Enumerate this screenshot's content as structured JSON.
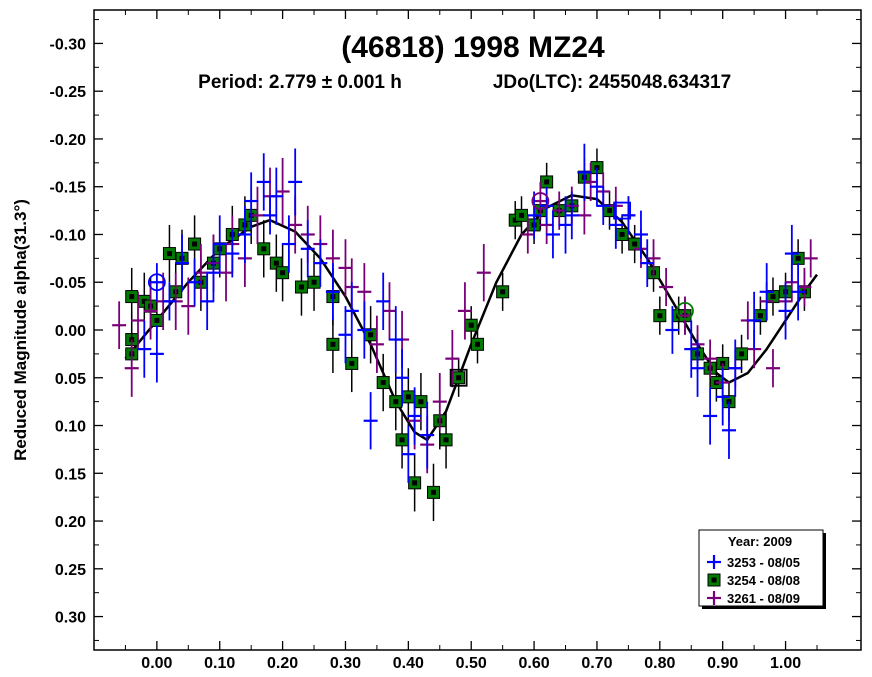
{
  "chart_data": {
    "type": "scatter",
    "title": "(46818) 1998 MZ24",
    "subtitle_period": "Period: 2.779 ± 0.001 h",
    "subtitle_epoch": "JDo(LTC): 2455048.634317",
    "ylabel": "Reduced Magnitude alpha(31.3°)",
    "xlabel": "",
    "xlim": [
      -0.1,
      1.12
    ],
    "ylim": [
      0.335,
      -0.335
    ],
    "y_inverted": true,
    "x_ticks": [
      "0.00",
      "0.10",
      "0.20",
      "0.30",
      "0.40",
      "0.50",
      "0.60",
      "0.70",
      "0.80",
      "0.90",
      "1.00"
    ],
    "y_ticks": [
      "-0.30",
      "-0.25",
      "-0.20",
      "-0.15",
      "-0.10",
      "-0.05",
      "0.00",
      "0.05",
      "0.10",
      "0.15",
      "0.20",
      "0.25",
      "0.30"
    ],
    "grid": false,
    "legend_position": "bottom-right",
    "legend_title": "Year: 2009",
    "series": [
      {
        "name": "3253 - 08/05",
        "marker": "plus",
        "color": "#0000ff",
        "points": [
          [
            -0.02,
            0.02,
            0.03
          ],
          [
            0.0,
            -0.05,
            0.02
          ],
          [
            0.0,
            0.025,
            0.03
          ],
          [
            0.02,
            -0.03,
            0.02
          ],
          [
            0.04,
            -0.07,
            0.03
          ],
          [
            0.06,
            -0.05,
            0.025
          ],
          [
            0.08,
            -0.03,
            0.03
          ],
          [
            0.09,
            -0.06,
            0.03
          ],
          [
            0.1,
            -0.09,
            0.03
          ],
          [
            0.12,
            -0.08,
            0.025
          ],
          [
            0.14,
            -0.1,
            0.03
          ],
          [
            0.15,
            -0.135,
            0.03
          ],
          [
            0.17,
            -0.155,
            0.03
          ],
          [
            0.18,
            -0.12,
            0.02
          ],
          [
            0.19,
            -0.14,
            0.03
          ],
          [
            0.21,
            -0.09,
            0.03
          ],
          [
            0.22,
            -0.155,
            0.035
          ],
          [
            0.24,
            -0.085,
            0.03
          ],
          [
            0.26,
            -0.07,
            0.025
          ],
          [
            0.28,
            -0.04,
            0.03
          ],
          [
            0.3,
            0.005,
            0.03
          ],
          [
            0.31,
            -0.02,
            0.03
          ],
          [
            0.33,
            0.0,
            0.03
          ],
          [
            0.34,
            0.095,
            0.03
          ],
          [
            0.36,
            -0.03,
            0.03
          ],
          [
            0.38,
            0.01,
            0.035
          ],
          [
            0.39,
            0.05,
            0.03
          ],
          [
            0.4,
            0.13,
            0.03
          ],
          [
            0.41,
            0.09,
            0.03
          ],
          [
            0.43,
            0.11,
            0.035
          ],
          [
            0.6,
            -0.12,
            0.025
          ],
          [
            0.62,
            -0.13,
            0.02
          ],
          [
            0.63,
            -0.1,
            0.025
          ],
          [
            0.65,
            -0.11,
            0.03
          ],
          [
            0.66,
            -0.12,
            0.025
          ],
          [
            0.68,
            -0.165,
            0.03
          ],
          [
            0.7,
            -0.15,
            0.02
          ],
          [
            0.71,
            -0.13,
            0.02
          ],
          [
            0.73,
            -0.11,
            0.025
          ],
          [
            0.75,
            -0.12,
            0.02
          ],
          [
            0.77,
            -0.1,
            0.025
          ],
          [
            0.78,
            -0.07,
            0.025
          ],
          [
            0.82,
            0.0,
            0.025
          ],
          [
            0.85,
            0.02,
            0.03
          ],
          [
            0.86,
            0.04,
            0.03
          ],
          [
            0.88,
            0.09,
            0.03
          ],
          [
            0.9,
            0.07,
            0.03
          ],
          [
            0.91,
            0.105,
            0.03
          ],
          [
            0.92,
            0.04,
            0.03
          ],
          [
            0.95,
            -0.01,
            0.03
          ],
          [
            0.97,
            -0.04,
            0.03
          ],
          [
            1.0,
            -0.02,
            0.03
          ],
          [
            1.01,
            -0.08,
            0.03
          ],
          [
            1.02,
            -0.04,
            0.03
          ]
        ]
      },
      {
        "name": "3254 - 08/08",
        "marker": "square",
        "color": "#007a00",
        "points": [
          [
            -0.04,
            0.01,
            0.03
          ],
          [
            -0.04,
            -0.035,
            0.03
          ],
          [
            -0.04,
            0.025,
            0.03
          ],
          [
            -0.02,
            -0.03,
            0.03
          ],
          [
            -0.01,
            -0.025,
            0.03
          ],
          [
            0.0,
            -0.01,
            0.02
          ],
          [
            0.02,
            -0.08,
            0.03
          ],
          [
            0.03,
            -0.04,
            0.03
          ],
          [
            0.04,
            -0.075,
            0.03
          ],
          [
            0.06,
            -0.09,
            0.03
          ],
          [
            0.07,
            -0.05,
            0.03
          ],
          [
            0.09,
            -0.07,
            0.03
          ],
          [
            0.1,
            -0.085,
            0.03
          ],
          [
            0.12,
            -0.1,
            0.03
          ],
          [
            0.14,
            -0.11,
            0.03
          ],
          [
            0.15,
            -0.12,
            0.03
          ],
          [
            0.17,
            -0.085,
            0.03
          ],
          [
            0.19,
            -0.07,
            0.03
          ],
          [
            0.2,
            -0.06,
            0.03
          ],
          [
            0.23,
            -0.045,
            0.03
          ],
          [
            0.25,
            -0.05,
            0.03
          ],
          [
            0.28,
            -0.035,
            0.03
          ],
          [
            0.28,
            0.015,
            0.03
          ],
          [
            0.31,
            0.035,
            0.03
          ],
          [
            0.34,
            0.005,
            0.03
          ],
          [
            0.36,
            0.055,
            0.03
          ],
          [
            0.38,
            0.075,
            0.03
          ],
          [
            0.39,
            0.115,
            0.03
          ],
          [
            0.4,
            0.07,
            0.03
          ],
          [
            0.41,
            0.16,
            0.03
          ],
          [
            0.42,
            0.075,
            0.03
          ],
          [
            0.44,
            0.17,
            0.03
          ],
          [
            0.45,
            0.095,
            0.03
          ],
          [
            0.46,
            0.115,
            0.03
          ],
          [
            0.48,
            0.05,
            0.02
          ],
          [
            0.5,
            -0.005,
            0.02
          ],
          [
            0.51,
            0.015,
            0.02
          ],
          [
            0.55,
            -0.04,
            0.02
          ],
          [
            0.57,
            -0.115,
            0.02
          ],
          [
            0.58,
            -0.12,
            0.02
          ],
          [
            0.6,
            -0.11,
            0.02
          ],
          [
            0.61,
            -0.125,
            0.02
          ],
          [
            0.62,
            -0.155,
            0.02
          ],
          [
            0.64,
            -0.125,
            0.02
          ],
          [
            0.66,
            -0.13,
            0.02
          ],
          [
            0.68,
            -0.16,
            0.02
          ],
          [
            0.7,
            -0.17,
            0.02
          ],
          [
            0.72,
            -0.125,
            0.02
          ],
          [
            0.74,
            -0.1,
            0.02
          ],
          [
            0.76,
            -0.09,
            0.02
          ],
          [
            0.79,
            -0.06,
            0.02
          ],
          [
            0.8,
            -0.015,
            0.02
          ],
          [
            0.83,
            -0.015,
            0.02
          ],
          [
            0.84,
            -0.015,
            0.02
          ],
          [
            0.86,
            0.025,
            0.02
          ],
          [
            0.88,
            0.04,
            0.02
          ],
          [
            0.89,
            0.055,
            0.02
          ],
          [
            0.9,
            0.035,
            0.02
          ],
          [
            0.91,
            0.075,
            0.02
          ],
          [
            0.93,
            0.025,
            0.02
          ],
          [
            0.96,
            -0.015,
            0.02
          ],
          [
            0.98,
            -0.035,
            0.02
          ],
          [
            1.0,
            -0.04,
            0.02
          ],
          [
            1.02,
            -0.075,
            0.02
          ],
          [
            1.03,
            -0.04,
            0.02
          ]
        ]
      },
      {
        "name": "3261 - 08/09",
        "marker": "plus",
        "color": "#7a007a",
        "points": [
          [
            -0.06,
            -0.005,
            0.025
          ],
          [
            -0.04,
            0.04,
            0.03
          ],
          [
            -0.03,
            -0.01,
            0.03
          ],
          [
            -0.01,
            -0.02,
            0.03
          ],
          [
            0.01,
            -0.03,
            0.03
          ],
          [
            0.03,
            -0.03,
            0.03
          ],
          [
            0.05,
            -0.025,
            0.03
          ],
          [
            0.07,
            -0.06,
            0.03
          ],
          [
            0.09,
            -0.07,
            0.03
          ],
          [
            0.11,
            -0.06,
            0.03
          ],
          [
            0.12,
            -0.09,
            0.03
          ],
          [
            0.14,
            -0.075,
            0.03
          ],
          [
            0.16,
            -0.12,
            0.03
          ],
          [
            0.18,
            -0.14,
            0.03
          ],
          [
            0.2,
            -0.145,
            0.035
          ],
          [
            0.22,
            -0.11,
            0.03
          ],
          [
            0.24,
            -0.1,
            0.03
          ],
          [
            0.26,
            -0.09,
            0.03
          ],
          [
            0.28,
            -0.075,
            0.03
          ],
          [
            0.3,
            -0.065,
            0.03
          ],
          [
            0.31,
            -0.045,
            0.03
          ],
          [
            0.33,
            -0.04,
            0.03
          ],
          [
            0.35,
            0.015,
            0.03
          ],
          [
            0.37,
            -0.02,
            0.03
          ],
          [
            0.39,
            0.01,
            0.03
          ],
          [
            0.41,
            0.095,
            0.03
          ],
          [
            0.43,
            0.12,
            0.03
          ],
          [
            0.45,
            0.075,
            0.03
          ],
          [
            0.47,
            0.03,
            0.03
          ],
          [
            0.49,
            -0.02,
            0.03
          ],
          [
            0.52,
            -0.06,
            0.03
          ],
          [
            0.59,
            -0.1,
            0.02
          ],
          [
            0.61,
            -0.135,
            0.02
          ],
          [
            0.62,
            -0.11,
            0.02
          ],
          [
            0.64,
            -0.125,
            0.02
          ],
          [
            0.66,
            -0.13,
            0.02
          ],
          [
            0.68,
            -0.12,
            0.02
          ],
          [
            0.69,
            -0.155,
            0.02
          ],
          [
            0.71,
            -0.145,
            0.02
          ],
          [
            0.73,
            -0.13,
            0.02
          ],
          [
            0.75,
            -0.12,
            0.02
          ],
          [
            0.77,
            -0.085,
            0.02
          ],
          [
            0.79,
            -0.075,
            0.02
          ],
          [
            0.81,
            -0.045,
            0.02
          ],
          [
            0.84,
            -0.015,
            0.02
          ],
          [
            0.86,
            0.015,
            0.02
          ],
          [
            0.88,
            0.03,
            0.02
          ],
          [
            0.9,
            0.055,
            0.02
          ],
          [
            0.92,
            0.04,
            0.02
          ],
          [
            0.94,
            -0.01,
            0.02
          ],
          [
            0.95,
            0.02,
            0.02
          ],
          [
            0.97,
            -0.03,
            0.02
          ],
          [
            0.98,
            0.04,
            0.02
          ],
          [
            1.0,
            -0.03,
            0.02
          ],
          [
            1.01,
            -0.05,
            0.02
          ],
          [
            1.03,
            -0.045,
            0.02
          ],
          [
            1.04,
            -0.075,
            0.02
          ]
        ]
      }
    ],
    "circled_points": [
      {
        "x": 0.0,
        "y": -0.05,
        "color": "#0000ff"
      },
      {
        "x": 0.61,
        "y": -0.135,
        "color": "#7a007a"
      },
      {
        "x": 0.84,
        "y": -0.02,
        "color": "#007a00"
      }
    ],
    "boxed_points": [
      {
        "x": 0.48,
        "y": 0.05,
        "color": "#000000"
      },
      {
        "x": 0.74,
        "y": -0.125,
        "color": "#0000ff"
      }
    ],
    "fit_curve": {
      "color": "#000000",
      "points": [
        [
          -0.05,
          0.03
        ],
        [
          0.0,
          -0.01
        ],
        [
          0.05,
          -0.05
        ],
        [
          0.1,
          -0.085
        ],
        [
          0.15,
          -0.108
        ],
        [
          0.18,
          -0.115
        ],
        [
          0.22,
          -0.103
        ],
        [
          0.26,
          -0.075
        ],
        [
          0.3,
          -0.035
        ],
        [
          0.34,
          0.015
        ],
        [
          0.38,
          0.075
        ],
        [
          0.41,
          0.107
        ],
        [
          0.43,
          0.115
        ],
        [
          0.46,
          0.085
        ],
        [
          0.5,
          0.015
        ],
        [
          0.54,
          -0.05
        ],
        [
          0.58,
          -0.1
        ],
        [
          0.62,
          -0.128
        ],
        [
          0.66,
          -0.141
        ],
        [
          0.7,
          -0.137
        ],
        [
          0.74,
          -0.113
        ],
        [
          0.78,
          -0.075
        ],
        [
          0.82,
          -0.03
        ],
        [
          0.86,
          0.015
        ],
        [
          0.89,
          0.045
        ],
        [
          0.91,
          0.055
        ],
        [
          0.94,
          0.045
        ],
        [
          0.97,
          0.02
        ],
        [
          1.0,
          -0.01
        ],
        [
          1.03,
          -0.04
        ],
        [
          1.05,
          -0.058
        ]
      ]
    }
  }
}
